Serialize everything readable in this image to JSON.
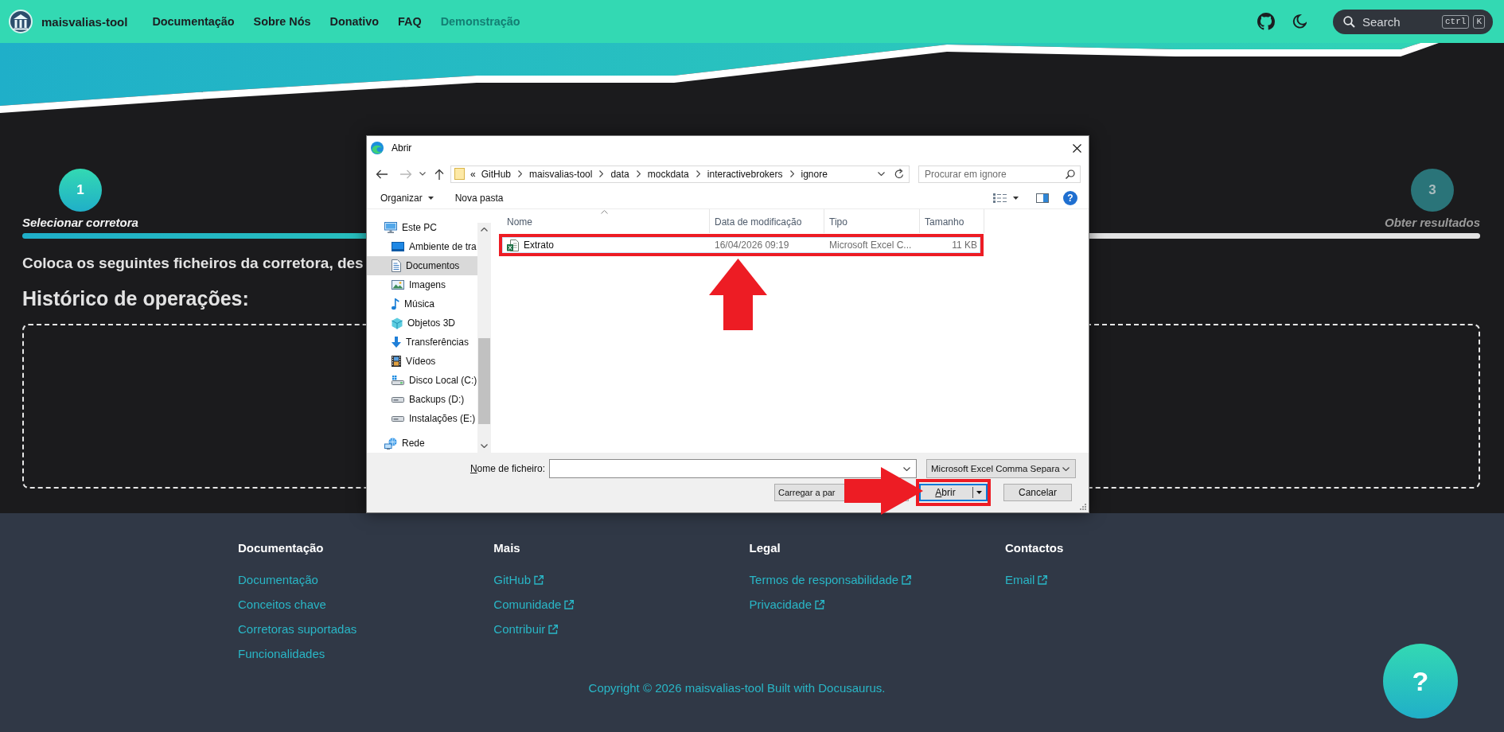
{
  "navbar": {
    "brand": "maisvalias-tool",
    "links": [
      {
        "label": "Documentação",
        "selected": false
      },
      {
        "label": "Sobre Nós",
        "selected": false
      },
      {
        "label": "Donativo",
        "selected": false
      },
      {
        "label": "FAQ",
        "selected": false
      },
      {
        "label": "Demonstração",
        "selected": true
      }
    ],
    "search": {
      "placeholder": "Search",
      "keys": [
        "ctrl",
        "K"
      ]
    }
  },
  "stepper": {
    "steps": [
      {
        "number": "1",
        "label": "Selecionar corretora",
        "selected": true
      },
      {
        "number": "3",
        "label": "Obter resultados",
        "selected": false
      }
    ]
  },
  "content": {
    "intro": "Coloca os seguintes ficheiros da corretora, des",
    "heading": "Histórico de operações:"
  },
  "dialog": {
    "title": "Abrir",
    "address": {
      "overflow_mark": "«",
      "segments": [
        "GitHub",
        "maisvalias-tool",
        "data",
        "mockdata",
        "interactivebrokers",
        "ignore"
      ]
    },
    "search": {
      "placeholder": "Procurar em ignore"
    },
    "toolbar": {
      "organize": "Organizar",
      "new_folder": "Nova pasta",
      "help": "?"
    },
    "nav_pane": [
      {
        "label": "Este PC",
        "kind": "computer",
        "selected": false,
        "children": [
          {
            "label": "Ambiente de tra",
            "kind": "desktop",
            "selected": false
          },
          {
            "label": "Documentos",
            "kind": "documents",
            "selected": true
          },
          {
            "label": "Imagens",
            "kind": "pictures",
            "selected": false
          },
          {
            "label": "Música",
            "kind": "music",
            "selected": false
          },
          {
            "label": "Objetos 3D",
            "kind": "objects3d",
            "selected": false
          },
          {
            "label": "Transferências",
            "kind": "downloads",
            "selected": false
          },
          {
            "label": "Vídeos",
            "kind": "videos",
            "selected": false
          },
          {
            "label": "Disco Local (C:)",
            "kind": "systemdrive",
            "selected": false
          },
          {
            "label": "Backups (D:)",
            "kind": "drive",
            "selected": false
          },
          {
            "label": "Instalações (E:)",
            "kind": "drive",
            "selected": false
          }
        ]
      },
      {
        "label": "Rede",
        "kind": "network",
        "selected": false
      }
    ],
    "columns": [
      {
        "label": "Nome",
        "sorted": true
      },
      {
        "label": "Data de modificação",
        "sorted": false
      },
      {
        "label": "Tipo",
        "sorted": false
      },
      {
        "label": "Tamanho",
        "sorted": false
      }
    ],
    "files": [
      {
        "name": "Extrato",
        "modified": "16/04/2026 09:19",
        "type": "Microsoft Excel C...",
        "size": "11 KB",
        "highlighted": true
      }
    ],
    "filename": {
      "label": "Nome de ficheiro:"
    },
    "filter": {
      "value": "Microsoft Excel Comma Separa"
    },
    "buttons": [
      {
        "label": "Carregar a par",
        "kind": "wide",
        "highlighted": false
      },
      {
        "label": "Abrir",
        "kind": "split",
        "highlighted": true
      },
      {
        "label": "Cancelar",
        "kind": "plain",
        "highlighted": false
      }
    ]
  },
  "footer": {
    "columns": [
      {
        "title": "Documentação",
        "links": [
          {
            "label": "Documentação",
            "external": false
          },
          {
            "label": "Conceitos chave",
            "external": false
          },
          {
            "label": "Corretoras suportadas",
            "external": false
          },
          {
            "label": "Funcionalidades",
            "external": false
          }
        ]
      },
      {
        "title": "Mais",
        "links": [
          {
            "label": "GitHub",
            "external": true
          },
          {
            "label": "Comunidade",
            "external": true
          },
          {
            "label": "Contribuir",
            "external": true
          }
        ]
      },
      {
        "title": "Legal",
        "links": [
          {
            "label": "Termos de responsabilidade",
            "external": true
          },
          {
            "label": "Privacidade",
            "external": true
          }
        ]
      },
      {
        "title": "Contactos",
        "links": [
          {
            "label": "Email",
            "external": true
          }
        ]
      }
    ],
    "copyright": "Copyright © 2026 maisvalias-tool Built with Docusaurus."
  },
  "help_button": {
    "label": "?"
  }
}
